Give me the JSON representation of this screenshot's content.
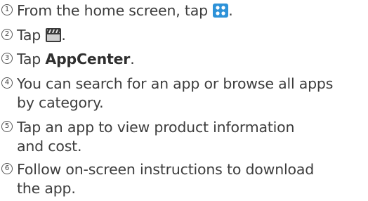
{
  "steps": [
    {
      "number": "1",
      "text_before": "From the home screen, tap ",
      "icon": "apps-grid-icon",
      "text_after": "."
    },
    {
      "number": "2",
      "text_before": "Tap ",
      "icon": "media-clapperboard-icon",
      "text_after": "."
    },
    {
      "number": "3",
      "text_before": "Tap ",
      "bold": "AppCenter",
      "text_after": "."
    },
    {
      "number": "4",
      "lines": [
        "You can search for an app or browse all apps",
        "by category."
      ]
    },
    {
      "number": "5",
      "lines": [
        "Tap an app to view product information",
        "and cost."
      ]
    },
    {
      "number": "6",
      "lines": [
        "Follow on-screen instructions to download",
        "the app."
      ]
    }
  ],
  "colors": {
    "text": "#3d3d3d",
    "apps_icon_bg": "#2e92d8",
    "media_icon_bg": "#3a3a3a"
  }
}
